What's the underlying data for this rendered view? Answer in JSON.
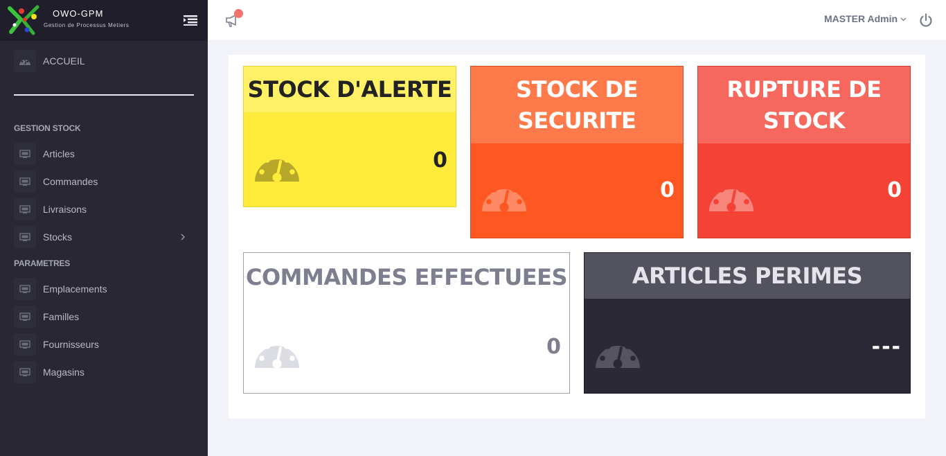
{
  "brand": {
    "name": "OWO-GPM",
    "subtitle": "Gestion de Processus Metiers"
  },
  "sidebar": {
    "home": {
      "label": "ACCUEIL",
      "icon": "dashboard-icon"
    },
    "sections": [
      {
        "title": "GESTION STOCK",
        "items": [
          {
            "label": "Articles",
            "icon": "monitor-icon"
          },
          {
            "label": "Commandes",
            "icon": "monitor-icon"
          },
          {
            "label": "Livraisons",
            "icon": "monitor-icon"
          },
          {
            "label": "Stocks",
            "icon": "monitor-icon",
            "submenu": true
          }
        ]
      },
      {
        "title": "PARAMETRES",
        "items": [
          {
            "label": "Emplacements",
            "icon": "monitor-icon"
          },
          {
            "label": "Familles",
            "icon": "monitor-icon"
          },
          {
            "label": "Fournisseurs",
            "icon": "monitor-icon"
          },
          {
            "label": "Magasins",
            "icon": "monitor-icon"
          }
        ]
      }
    ]
  },
  "topbar": {
    "user": "MASTER Admin",
    "icons": [
      "megaphone-icon",
      "chevron-down-icon",
      "power-icon"
    ]
  },
  "cards": [
    {
      "title": "STOCK D'ALERTE",
      "value": "0",
      "color": "#ffeb3b"
    },
    {
      "title": "STOCK DE SECURITE",
      "value": "0",
      "color": "#ff5722"
    },
    {
      "title": "RUPTURE DE STOCK",
      "value": "0",
      "color": "#f44336"
    },
    {
      "title": "COMMANDES EFFECTUEES",
      "value": "0",
      "color": "#ffffff"
    },
    {
      "title": "ARTICLES PERIMES",
      "value": "---",
      "color": "#2a2935"
    }
  ],
  "colors": {
    "sidebar": "#282733",
    "brand_bar": "#1f1e2a",
    "notification": "#f4736c"
  }
}
